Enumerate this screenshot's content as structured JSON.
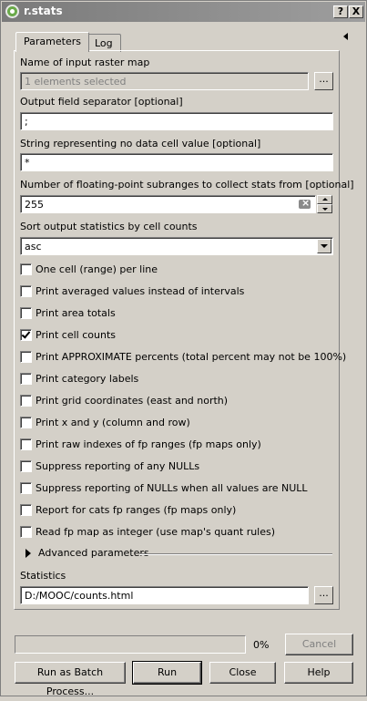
{
  "window": {
    "title": "r.stats",
    "help_btn": "?",
    "close_btn": "X"
  },
  "tabs": [
    {
      "label": "Parameters",
      "active": true
    },
    {
      "label": "Log",
      "active": false
    }
  ],
  "params": {
    "input_raster": {
      "label": "Name of input raster map",
      "value": "1 elements selected",
      "button": "..."
    },
    "separator": {
      "label": "Output field separator [optional]",
      "value": ";"
    },
    "nodata": {
      "label": "String representing no data cell value [optional]",
      "value": "*"
    },
    "subranges": {
      "label": "Number of floating-point subranges to collect stats from [optional]",
      "value": "255"
    },
    "sort": {
      "label": "Sort output statistics by cell counts",
      "value": "asc"
    }
  },
  "checkboxes": [
    {
      "label": "One cell (range) per line",
      "checked": false
    },
    {
      "label": "Print averaged values instead of intervals",
      "checked": false
    },
    {
      "label": "Print area totals",
      "checked": false
    },
    {
      "label": "Print cell counts",
      "checked": true
    },
    {
      "label": "Print APPROXIMATE percents (total percent may not be 100%)",
      "checked": false
    },
    {
      "label": "Print category labels",
      "checked": false
    },
    {
      "label": "Print grid coordinates (east and north)",
      "checked": false
    },
    {
      "label": "Print x and y (column and row)",
      "checked": false
    },
    {
      "label": "Print raw indexes of fp ranges (fp maps only)",
      "checked": false
    },
    {
      "label": "Suppress reporting of any NULLs",
      "checked": false
    },
    {
      "label": "Suppress reporting of NULLs when all values are NULL",
      "checked": false
    },
    {
      "label": "Report for cats fp ranges (fp maps only)",
      "checked": false
    },
    {
      "label": "Read fp map as integer (use map's quant rules)",
      "checked": false
    }
  ],
  "advanced": {
    "label": "Advanced parameters"
  },
  "statistics": {
    "label": "Statistics",
    "value": "D:/MOOC/counts.html",
    "button": "..."
  },
  "progress": {
    "value": 0,
    "text": "0%"
  },
  "buttons": {
    "cancel": "Cancel",
    "batch": "Run as Batch Process...",
    "run": "Run",
    "close": "Close",
    "help": "Help"
  }
}
